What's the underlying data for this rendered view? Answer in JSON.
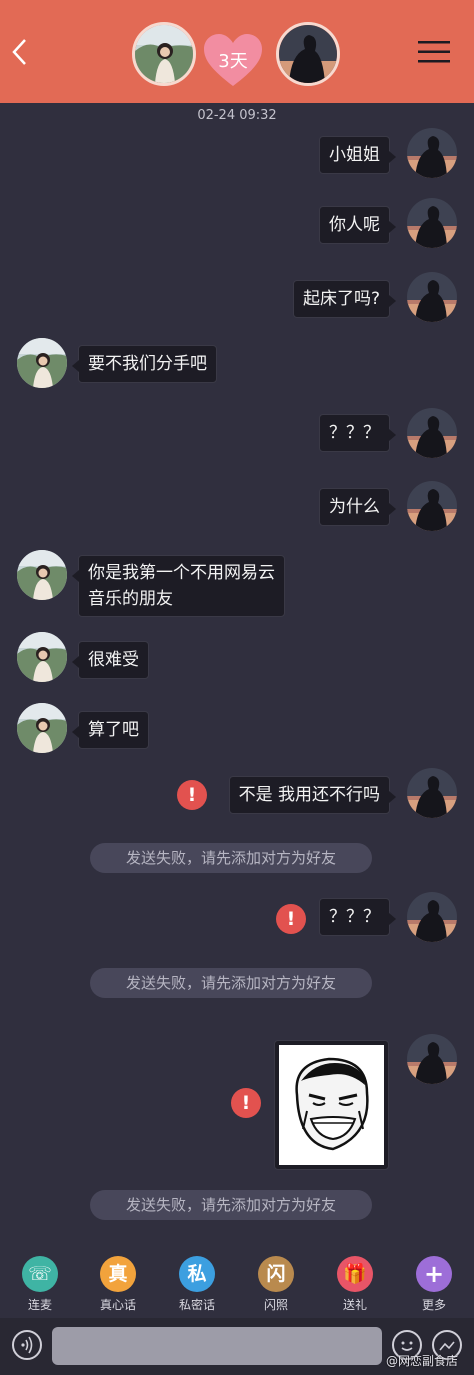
{
  "header": {
    "streak": "3天",
    "colors": {
      "bar": "#e26a55",
      "heart": "#f28da1"
    }
  },
  "chat": {
    "timestamp": "02-24 09:32",
    "messages": [
      {
        "from": "me",
        "text": "小姐姐"
      },
      {
        "from": "me",
        "text": "你人呢"
      },
      {
        "from": "me",
        "text": "起床了吗?"
      },
      {
        "from": "her",
        "text": "要不我们分手吧"
      },
      {
        "from": "me",
        "text": "？？？"
      },
      {
        "from": "me",
        "text": "为什么"
      },
      {
        "from": "her",
        "text_line1": "你是我第一个不用网易云",
        "text_line2": "音乐的朋友"
      },
      {
        "from": "her",
        "text": "很难受"
      },
      {
        "from": "her",
        "text": "算了吧"
      },
      {
        "from": "me",
        "text": "不是 我用还不行吗",
        "failed": true
      },
      {
        "from": "me",
        "text": "？？？",
        "failed": true
      },
      {
        "from": "me",
        "type": "sticker",
        "failed": true
      }
    ],
    "fail_notice": "发送失败，请先添加对方为好友",
    "error_mark": "!"
  },
  "toolbar": {
    "items": [
      {
        "label": "连麦",
        "glyph": "☏",
        "color": "#3fb4a4"
      },
      {
        "label": "真心话",
        "glyph": "真",
        "color": "#f2a33c"
      },
      {
        "label": "私密话",
        "glyph": "私",
        "color": "#3c9fe0"
      },
      {
        "label": "闪照",
        "glyph": "闪",
        "color": "#b98a4e"
      },
      {
        "label": "送礼",
        "glyph": "🎁",
        "color": "#e85567"
      },
      {
        "label": "更多",
        "glyph": "+",
        "color": "#9d6ed8"
      }
    ]
  },
  "input": {
    "placeholder": ""
  },
  "watermark": "@网恋副食店"
}
